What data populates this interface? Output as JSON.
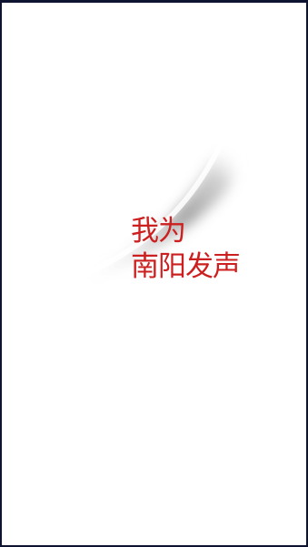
{
  "splash": {
    "slogan_line1": "我为",
    "slogan_line2": "南阳发声",
    "slogan_color": "#cc1f1f",
    "background_color": "#ffffff",
    "frame_color": "#0e1430"
  }
}
